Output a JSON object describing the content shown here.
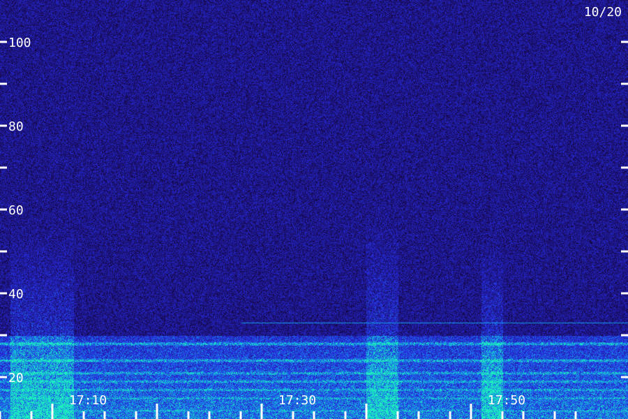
{
  "date_label": "10/20",
  "chart_data": {
    "type": "heatmap",
    "title": "",
    "xlabel": "",
    "ylabel": "",
    "ylim": [
      10,
      110
    ],
    "y_ticks_labeled": [
      20,
      40,
      60,
      80,
      100
    ],
    "y_ticks_all": [
      20,
      30,
      40,
      50,
      60,
      70,
      80,
      90,
      100
    ],
    "x_start_time": "17:02",
    "x_end_time": "17:62",
    "x_ticks_labeled": [
      "17:10",
      "17:30",
      "17:50"
    ],
    "x_ticks_all_minutes": [
      2,
      5,
      7,
      10,
      12,
      15,
      17,
      20,
      22,
      25,
      27,
      30,
      32,
      35,
      37,
      40,
      42,
      45,
      47,
      50,
      52,
      55,
      57
    ],
    "x_ticks_major_minutes": [
      7,
      17,
      27,
      37,
      47
    ],
    "noise_floor_color": "#1a0a5e",
    "band_low_color": "#1c3ae0",
    "band_high_color": "#20e0c8",
    "strong_bands_freq": [
      12,
      15,
      17,
      19,
      21,
      24,
      28
    ],
    "continuous_line_freq": 33,
    "broadband_bursts": [
      {
        "start_min": 3,
        "end_min": 9,
        "max_freq": 55
      },
      {
        "start_min": 37,
        "end_min": 40,
        "max_freq": 58
      },
      {
        "start_min": 48,
        "end_min": 50,
        "max_freq": 52
      }
    ]
  }
}
